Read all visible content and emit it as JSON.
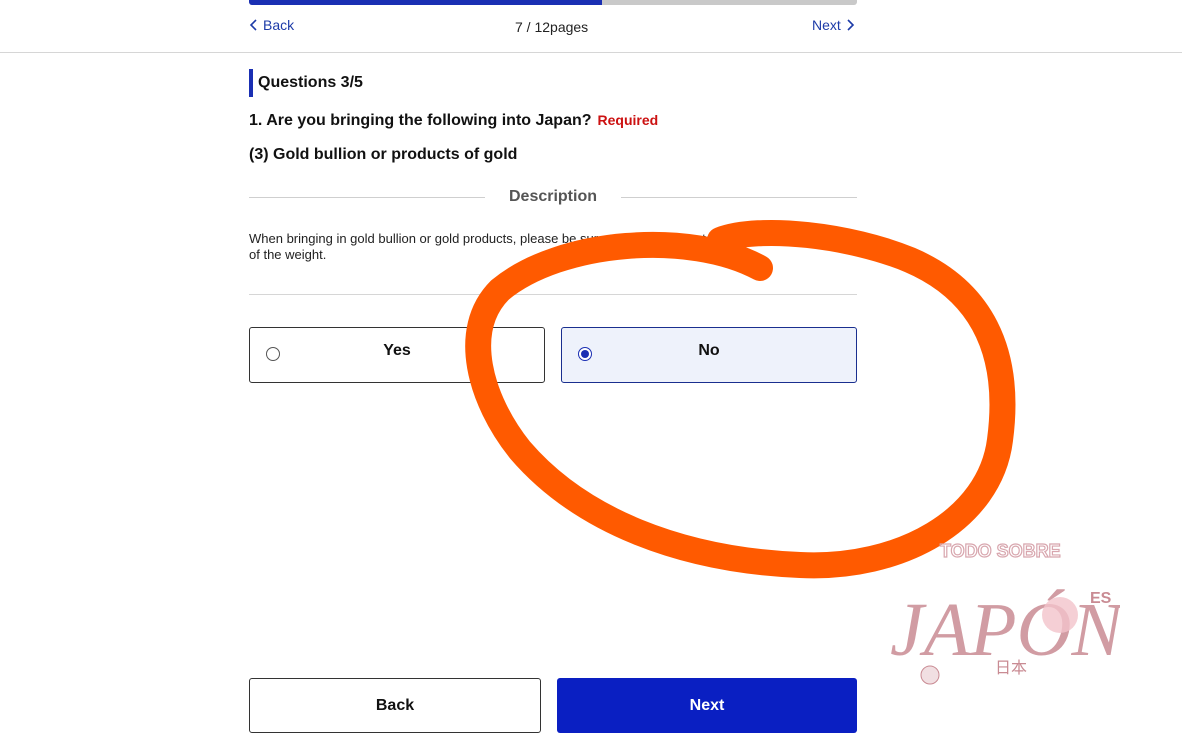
{
  "progress": {
    "fraction": 0.58
  },
  "topnav": {
    "back_label": "Back",
    "page_indicator": "7 / 12pages",
    "next_label": "Next"
  },
  "question": {
    "heading": "Questions 3/5",
    "text": "1. Are you bringing the following into Japan?",
    "required_label": "Required",
    "subtext": "(3) Gold bullion or products of gold"
  },
  "description": {
    "title": "Description",
    "body": "When bringing in gold bullion or gold products, please be sure to declare them to the Customs regardless of the weight."
  },
  "options": [
    {
      "label": "Yes",
      "selected": false
    },
    {
      "label": "No",
      "selected": true
    }
  ],
  "footer": {
    "back_label": "Back",
    "next_label": "Next"
  },
  "watermark": {
    "text_top": "TODO SOBRE",
    "text_main": "JAPÓN",
    "text_suffix": "ES",
    "text_kanji": "日本"
  },
  "colors": {
    "brand_blue": "#0a1fc2",
    "required_red": "#cc1111",
    "annotation_orange": "#ff5a00"
  }
}
